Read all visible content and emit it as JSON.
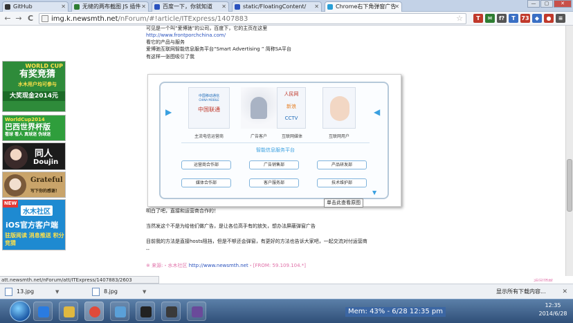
{
  "browser": {
    "tabs": [
      {
        "label": "GitHub",
        "icon": "github-icon",
        "color": "#333333",
        "active": false
      },
      {
        "label": "无缝的两布截图 JS 插件",
        "icon": "page-icon",
        "color": "#2e7d32",
        "active": false
      },
      {
        "label": "百度一下，你就知道",
        "icon": "baidu-icon",
        "color": "#2a52be",
        "active": false
      },
      {
        "label": "static/FloatingContent/",
        "icon": "folder-icon",
        "color": "#2a52be",
        "active": false
      },
      {
        "label": "Chrome右下角弹窗广告",
        "icon": "newsmth-icon",
        "color": "#2a9fd6",
        "active": true
      }
    ],
    "window_buttons": [
      "—",
      "▢",
      "✕"
    ],
    "nav": {
      "back": "←",
      "forward": "→",
      "reload": "C"
    },
    "url_host": "img.k.newsmth.net",
    "url_path": "/nForum/#!article/ITExpress/1407883",
    "star": "☆",
    "extensions": [
      {
        "name": "toolbar-red-icon",
        "label": "T",
        "color": "#c0392b"
      },
      {
        "name": "email-icon",
        "label": "✉",
        "color": "#2e7d32"
      },
      {
        "name": "font-icon",
        "label": "f?",
        "color": "#555555"
      },
      {
        "name": "blue-t-icon",
        "label": "T",
        "color": "#3a6fc4"
      },
      {
        "name": "badge-icon",
        "label": "73",
        "color": "#c0392b"
      },
      {
        "name": "shield-icon",
        "label": "◆",
        "color": "#3a6fc4"
      },
      {
        "name": "stop-icon",
        "label": "●",
        "color": "#c0392b"
      },
      {
        "name": "menu-icon",
        "label": "≡",
        "color": "#555555"
      }
    ]
  },
  "sidebar": {
    "banners": [
      {
        "name": "banner-world-cup-quiz",
        "lines": [
          "WORLD CUP",
          "有奖竞猜",
          "水木用户均可参与",
          "大奖现金2014元"
        ],
        "bg": "#2e8b3a",
        "fg": "#ffffff"
      },
      {
        "name": "banner-world-cup-brazil",
        "lines": [
          "WorldCup2014",
          "巴西世界杯版",
          "看球 看人 真球迷 伪球迷"
        ],
        "bg": "#2f9e3c",
        "fg": "#ffffff"
      },
      {
        "name": "banner-doujin",
        "lines": [
          "同人",
          "Doujin"
        ],
        "bg": "#1b1b1b",
        "fg": "#ffffff"
      },
      {
        "name": "banner-grateful",
        "lines": [
          "Grateful",
          "写下你的感谢！"
        ],
        "bg": "#c9a46a",
        "fg": "#3a2a10"
      },
      {
        "name": "banner-ios-client",
        "lines": [
          "NEW",
          "水木社区",
          "iOS官方客户端",
          "驻版阅读 消息推送 积分竞猜"
        ],
        "bg": "#1e8ad1",
        "fg": "#ffffff"
      }
    ]
  },
  "article": {
    "line1": "可见是一个叫“爱博驰”的公司，百度下，它的主页在这里",
    "link1": "http://www.frontporchchina.com/",
    "line2": "看它的产品与服务",
    "line3": "爱博驰互联网智能信息服务平台“Smart Advertising ” 简称SA平台",
    "line4": "有这样一张图吸引了我",
    "image_tooltip": "单击此查看原图",
    "diagram": {
      "nodes": [
        "主流电信运营商",
        "广告客户",
        "互联网媒体",
        "互联网用户"
      ],
      "platform": "智能信息服务平台",
      "depts": [
        "运营商合作部",
        "广告销售部",
        "产品研发部",
        "媒体合作部",
        "客户服务部",
        "技术维护部"
      ],
      "logo_text": [
        "中国移动通信",
        "CHINA MOBILE",
        "中国联通"
      ],
      "media_text": [
        "人民网",
        "新浪",
        "CCTV"
      ]
    },
    "line5": "明白了吧，直接和运营商合作的！",
    "line6": "当然发这个不是为给他们做广告，是让各位高手有的放矢，想办法屏蔽弹窗广告",
    "line7": "目前我的方法是直接hosts阻挡，但是不够还会弹窗，有更好的方法也告诉大家吧，一起交流对付运营商",
    "line8": "--",
    "footer_prefix": "※ 来源:・水木社区 ",
    "footer_link": "http://www.newsmth.net",
    "footer_suffix": "・[FROM: 59.109.104.*]",
    "cut_text": "返回顶部"
  },
  "status_url": "att.newsmth.net/nForum/att/ITExpress/1407883/2603",
  "downloads": {
    "items": [
      {
        "name": "13.jpg"
      },
      {
        "name": "8.jpg"
      }
    ],
    "show_all": "显示所有下载内容...",
    "close": "✕"
  },
  "taskbar": {
    "apps": [
      "ie-icon",
      "explorer-icon",
      "chrome-icon",
      "app-icon",
      "cmd-icon",
      "monitor-icon",
      "eclipse-icon"
    ],
    "memory": "Mem: 43% - 6/28  12:35 pm",
    "time": "12:35",
    "date": "2014/6/28"
  }
}
